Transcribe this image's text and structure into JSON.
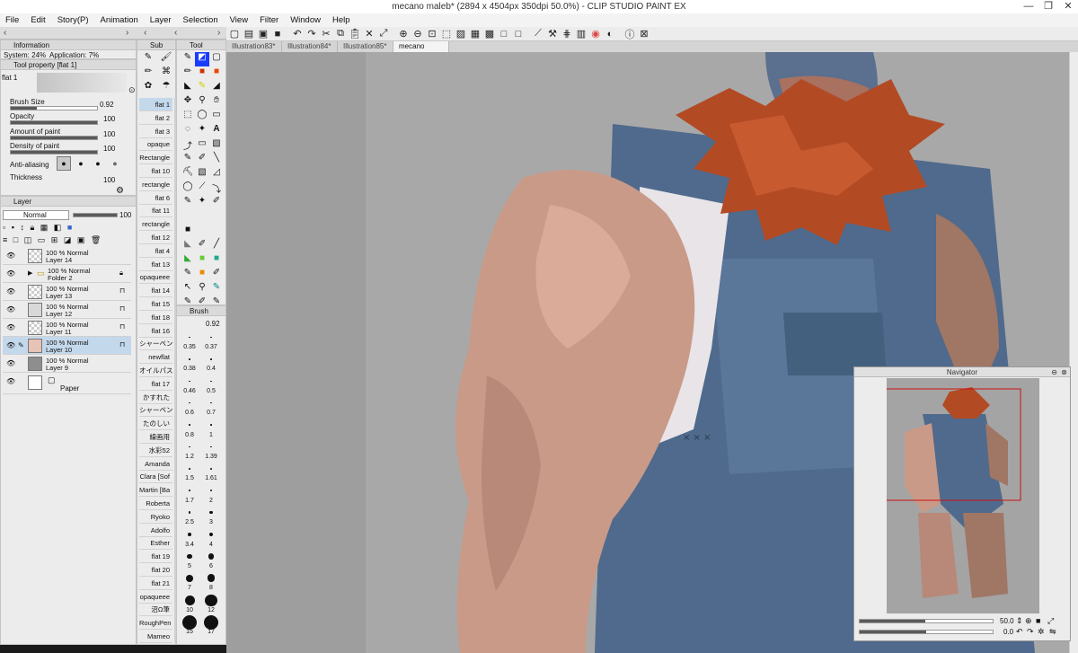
{
  "window": {
    "title": "mecano maleb* (2894 x 4504px 350dpi 50.0%) - CLIP STUDIO PAINT EX",
    "controls": [
      "—",
      "❐",
      "✕"
    ]
  },
  "menu": [
    "File",
    "Edit",
    "Story(P)",
    "Animation",
    "Layer",
    "Selection",
    "View",
    "Filter",
    "Window",
    "Help"
  ],
  "tabs": [
    {
      "label": "Illustration83*",
      "active": false
    },
    {
      "label": "Illustration84*",
      "active": false
    },
    {
      "label": "Illustration85*",
      "active": false
    },
    {
      "label": "mecano maleb*",
      "active": true
    }
  ],
  "panel_tabs": {
    "information": "Information",
    "sub": "Sub",
    "tool": "Tool",
    "layer": "Layer",
    "brush": "Brush"
  },
  "info": {
    "system": "System: 24%",
    "application": "Application:  7%"
  },
  "tool_property": {
    "title": "Tool property [flat 1]",
    "preset": "flat 1",
    "brush_size": {
      "label": "Brush Size",
      "value": "0.92"
    },
    "opacity": {
      "label": "Opacity",
      "value": "100"
    },
    "amount": {
      "label": "Amount of paint",
      "value": "100"
    },
    "density": {
      "label": "Density of paint",
      "value": "100"
    },
    "antialias": {
      "label": "Anti-aliasing"
    },
    "thickness": {
      "label": "Thickness",
      "value": "100"
    }
  },
  "layer_panel": {
    "blend_mode": "Normal",
    "opacity": "100",
    "layers": [
      {
        "mode": "100 % Normal",
        "name": "Layer 14",
        "folder": false,
        "selected": false
      },
      {
        "mode": "100 % Normal",
        "name": "Folder 2",
        "folder": true,
        "selected": false
      },
      {
        "mode": "100 % Normal",
        "name": "Layer 13",
        "folder": false,
        "selected": false
      },
      {
        "mode": "100 % Normal",
        "name": "Layer 12",
        "folder": false,
        "selected": false
      },
      {
        "mode": "100 % Normal",
        "name": "Layer 11",
        "folder": false,
        "selected": false
      },
      {
        "mode": "100 % Normal",
        "name": "Layer 10",
        "folder": false,
        "selected": true
      },
      {
        "mode": "100 % Normal",
        "name": "Layer 9",
        "folder": false,
        "selected": false
      },
      {
        "mode": "",
        "name": "Paper",
        "folder": false,
        "selected": false
      }
    ]
  },
  "subtools": [
    "flat 1",
    "flat 2",
    "flat 3",
    "opaque",
    "Rectangle",
    "flat 10",
    "rectangle",
    "flat 6",
    "flat 11",
    "rectangle",
    "flat 12",
    "flat 4",
    "flat 13",
    "opaqueee",
    "flat 14",
    "flat 15",
    "flat 18",
    "flat 16",
    "シャーペン",
    "newflat",
    "オイルパス",
    "flat 17",
    "かすれた",
    "シャーペン",
    "たのしい",
    "線画用",
    "水彩52",
    "Amanda",
    "Clara [Sof",
    "Martin [Ba",
    "Roberta",
    "Ryoko",
    "Adolfo",
    "Esther",
    "flat 19",
    "flat 20",
    "flat 21",
    "opaqueee",
    "沼Ω筆",
    "RoughPen",
    "Mameo"
  ],
  "brush_sizes": [
    "0.35",
    "0.37",
    "0.38",
    "0.4",
    "0.46",
    "0.5",
    "0.6",
    "0.7",
    "0.8",
    "1",
    "1.2",
    "1.39",
    "1.5",
    "1.61",
    "1.7",
    "2",
    "2.5",
    "3",
    "3.4",
    "4",
    "5",
    "6",
    "7",
    "8",
    "10",
    "12",
    "15",
    "17"
  ],
  "brush_panel_value": "0.92",
  "navigator": {
    "title": "Navigator",
    "zoom": "50.0",
    "rotation": "0.0"
  }
}
